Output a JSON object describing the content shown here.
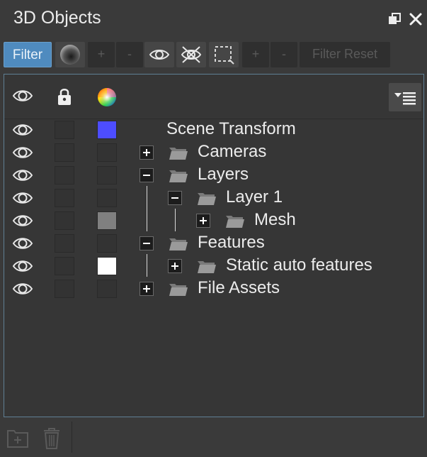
{
  "window": {
    "title": "3D Objects",
    "float_icon": "float-window-icon",
    "close_icon": "close-icon"
  },
  "toolbar": {
    "filter_label": "Filter",
    "sphere_icon": "material-sphere-icon",
    "add_label": "+",
    "remove_label": "-",
    "show_icon": "eye-icon",
    "hide_icon": "eye-crossed-icon",
    "select_icon": "selection-marquee-icon",
    "add2_label": "+",
    "remove2_label": "-",
    "filter_reset_label": "Filter Reset"
  },
  "tree": {
    "header": {
      "visibility_icon": "eye-icon",
      "lock_icon": "lock-icon",
      "color_icon": "color-wheel-icon",
      "menu_icon": "filter-list-icon"
    },
    "rows": [
      {
        "label": "Scene Transform",
        "color": "#4d4dff",
        "expander": "",
        "folder": false
      },
      {
        "label": "Cameras",
        "color": "",
        "expander": "+",
        "folder": true
      },
      {
        "label": "Layers",
        "color": "",
        "expander": "−",
        "folder": true
      },
      {
        "label": "Layer 1",
        "color": "",
        "expander": "−",
        "folder": true
      },
      {
        "label": "Mesh",
        "color": "#808080",
        "expander": "+",
        "folder": true
      },
      {
        "label": "Features",
        "color": "",
        "expander": "−",
        "folder": true
      },
      {
        "label": "Static auto features",
        "color": "#ffffff",
        "expander": "+",
        "folder": true
      },
      {
        "label": "File Assets",
        "color": "",
        "expander": "+",
        "folder": true
      }
    ]
  },
  "bottom": {
    "new_folder_icon": "new-folder-icon",
    "delete_icon": "trash-icon"
  }
}
